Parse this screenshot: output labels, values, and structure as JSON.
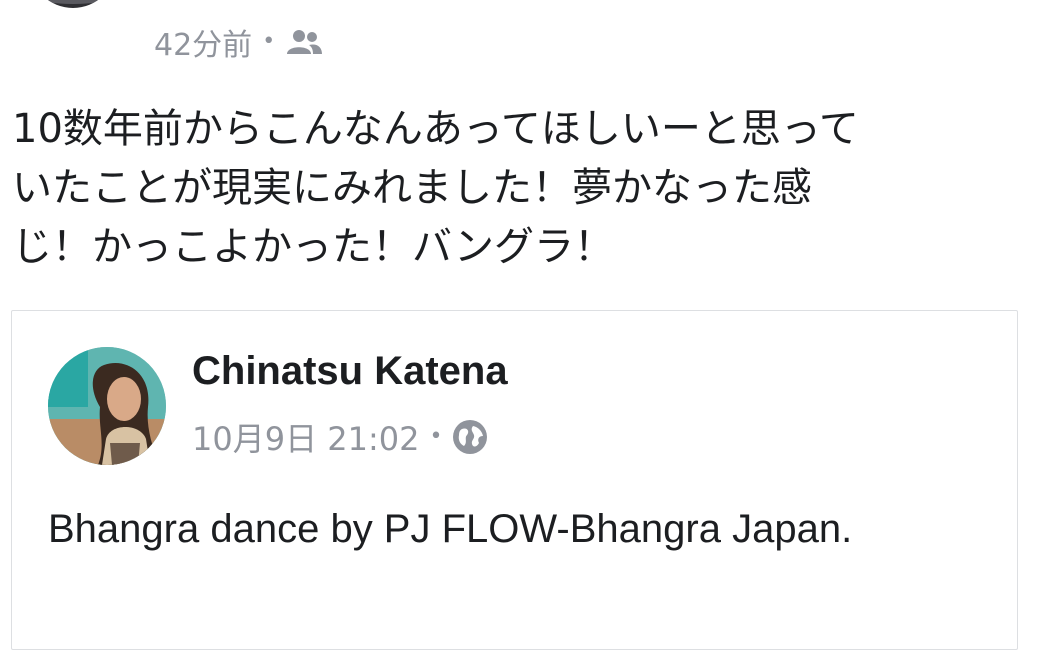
{
  "post": {
    "time": "42分前",
    "separator": "•",
    "audience_icon": "friends-icon",
    "text": "10数年前からこんなんあってほしいーと思って\nいたことが現実にみれました！夢かなった感\nじ！かっこよかった！バングラ！"
  },
  "shared_post": {
    "author": "Chinatsu Katena",
    "timestamp": "10月9日 21:02",
    "separator": "•",
    "audience_icon": "globe-icon",
    "text": "Bhangra dance by PJ FLOW-Bhangra Japan."
  },
  "colors": {
    "meta_text": "#90949c",
    "body_text": "#1c1e21",
    "card_border": "#dddfe2"
  }
}
